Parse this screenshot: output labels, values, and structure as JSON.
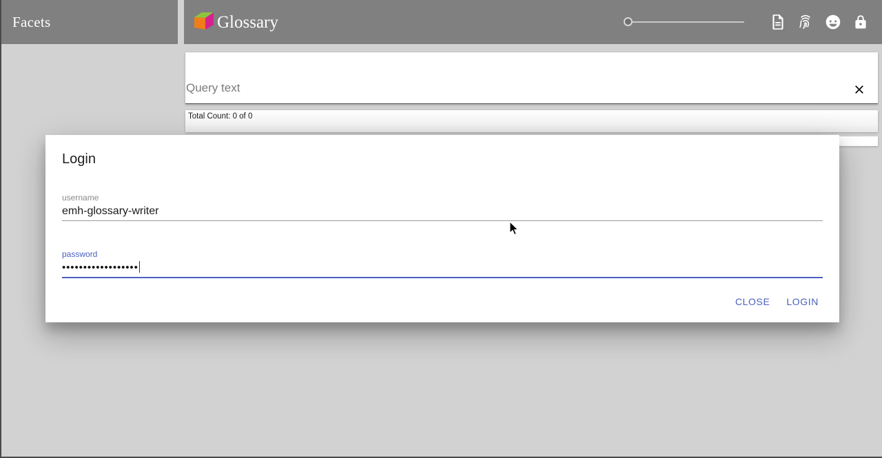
{
  "header": {
    "facets_label": "Facets",
    "brand_name": "Glossary",
    "logo_colors": {
      "top": "#8cc63e",
      "left": "#f07d1a",
      "right": "#d6218f"
    },
    "bar_color": "#808080",
    "icons": [
      {
        "name": "document-icon",
        "label": "Document"
      },
      {
        "name": "fingerprint-icon",
        "label": "Fingerprint"
      },
      {
        "name": "face-icon",
        "label": "Face"
      },
      {
        "name": "lock-icon",
        "label": "Lock"
      }
    ],
    "zoom_slider": {
      "name": "zoom-slider",
      "value": 0
    }
  },
  "query": {
    "placeholder": "Query text",
    "value": "",
    "clear_icon": "close-icon",
    "total_count": "Total Count: 0 of 0"
  },
  "dialog": {
    "title": "Login",
    "username": {
      "label": "username",
      "value": "emh-glossary-writer",
      "focused": false
    },
    "password": {
      "label": "password",
      "value": "••••••••••••••••••",
      "focused": true
    },
    "buttons": {
      "close_label": "CLOSE",
      "login_label": "LOGIN"
    },
    "accent_color": "#4a5fc1"
  },
  "background_color": "#d2d2d2"
}
